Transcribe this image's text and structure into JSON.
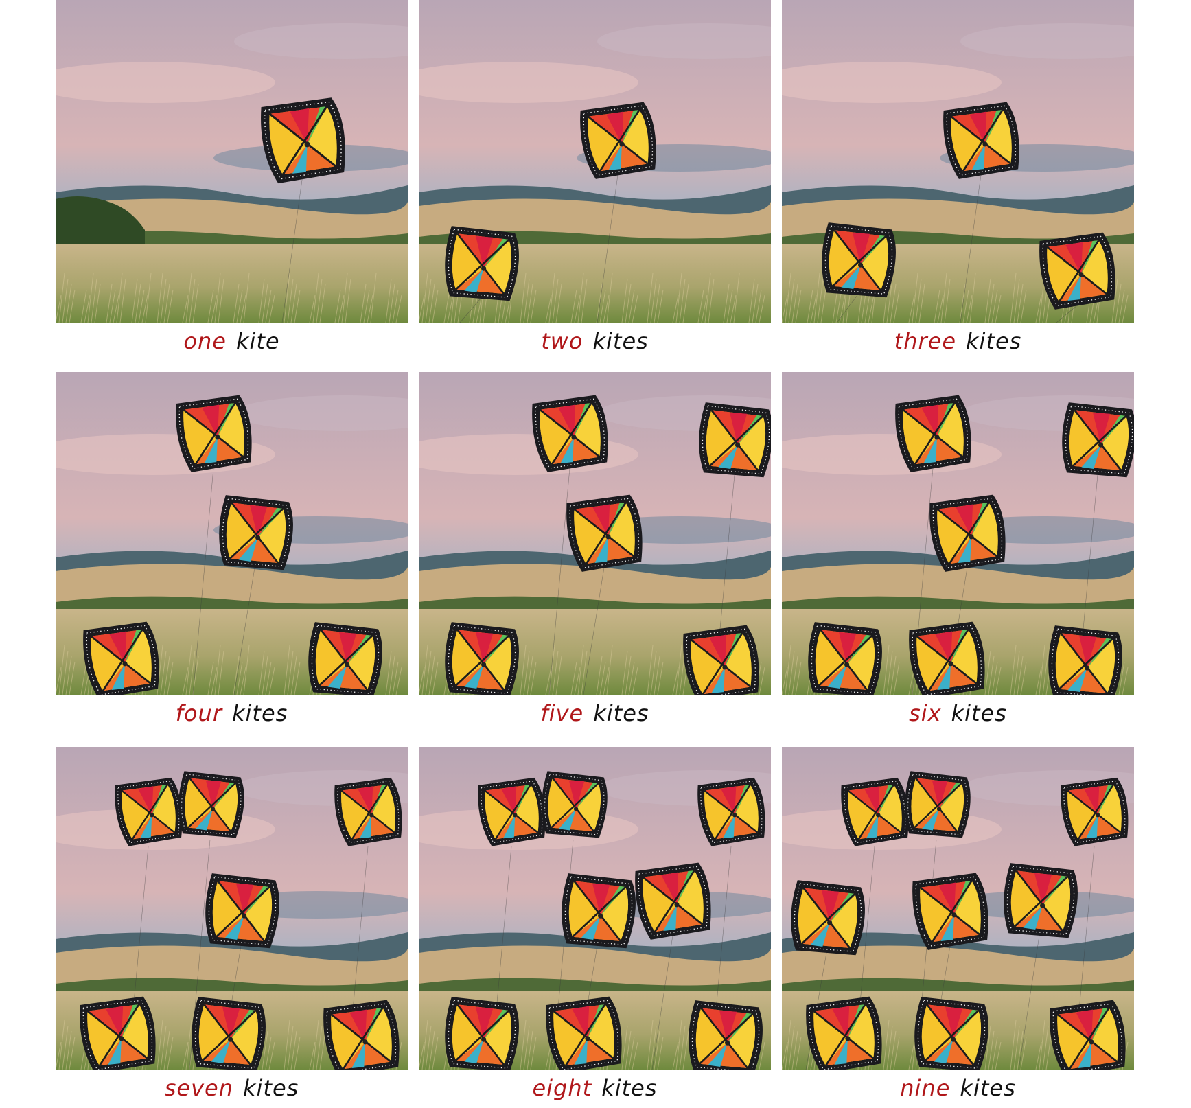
{
  "colors": {
    "number_text": "#b0171a",
    "noun_text": "#111111"
  },
  "panels": [
    {
      "number": "one",
      "noun": "kite",
      "kite_count": 1
    },
    {
      "number": "two",
      "noun": "kites",
      "kite_count": 2
    },
    {
      "number": "three",
      "noun": "kites",
      "kite_count": 3
    },
    {
      "number": "four",
      "noun": "kites",
      "kite_count": 4
    },
    {
      "number": "five",
      "noun": "kites",
      "kite_count": 5
    },
    {
      "number": "six",
      "noun": "kites",
      "kite_count": 6
    },
    {
      "number": "seven",
      "noun": "kites",
      "kite_count": 7
    },
    {
      "number": "eight",
      "noun": "kites",
      "kite_count": 8
    },
    {
      "number": "nine",
      "noun": "kites",
      "kite_count": 9
    }
  ]
}
